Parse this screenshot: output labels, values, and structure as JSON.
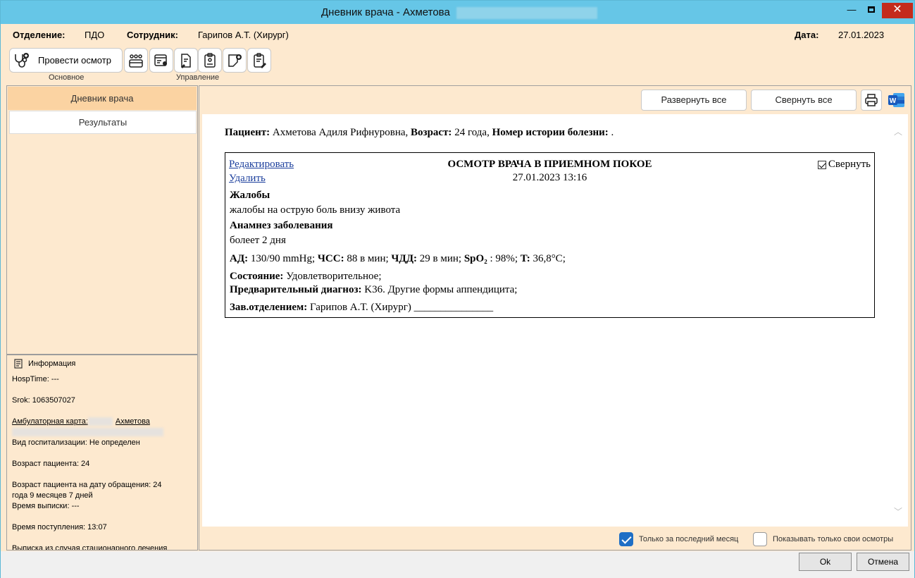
{
  "window": {
    "title": "Дневник врача - Ахметова",
    "minimize": "—",
    "close": "✕"
  },
  "header": {
    "dept_label": "Отделение:",
    "dept_value": "ПДО",
    "employee_label": "Сотрудник:",
    "employee_value": "Гарипов А.Т. (Хирург)",
    "date_label": "Дата:",
    "date_value": "27.01.2023"
  },
  "toolbar": {
    "exam_button": "Провести осмотр",
    "group_main": "Основное",
    "group_manage": "Управление"
  },
  "sidebar": {
    "items": [
      {
        "label": "Дневник врача"
      },
      {
        "label": "Результаты"
      }
    ]
  },
  "info": {
    "title": "Информация",
    "hosp_time": "HospTime: ---",
    "srok": "Srok: 1063507027",
    "amb_card_label": "Амбулаторная карта:",
    "amb_card_name": "Ахметова",
    "hosp_type": "Вид госпитализации: Не определен",
    "age": "Возраст пациента: 24",
    "age_at_visit_1": "Возраст пациента на дату обращения: 24",
    "age_at_visit_2": "года 9 месяцев 7 дней",
    "discharge_time": "Время выписки: ---",
    "admission_time": "Время поступления: 13:07",
    "extract": "Выписка из случая стационарного лечения"
  },
  "actions": {
    "expand_all": "Развернуть все",
    "collapse_all": "Свернуть все"
  },
  "document": {
    "patient_label": "Пациент:",
    "patient_name": "Ахметова Адиля Рифнуровна,",
    "age_label": "Возраст:",
    "age_value": "24 года,",
    "history_label": "Номер истории болезни:",
    "history_value": ".",
    "exam": {
      "edit": "Редактировать",
      "delete": "Удалить",
      "title": "ОСМОТР ВРАЧА В ПРИЕМНОМ ПОКОЕ",
      "datetime": "27.01.2023 13:16",
      "collapse_label": "Свернуть",
      "complaints_title": "Жалобы",
      "complaints_text": "жалобы на острую боль внизу живота",
      "anamnesis_title": "Анамнез заболевания",
      "anamnesis_text": "болеет 2 дня",
      "bp_label": "АД:",
      "bp_value": "130/90 mmHg;",
      "hr_label": "ЧСС:",
      "hr_value": "88 в мин;",
      "rr_label": "ЧДД:",
      "rr_value": "29 в мин;",
      "spo2_label": "SpO₂",
      "spo2_value": ": 98%;",
      "temp_label": "T:",
      "temp_value": "36,8°C;",
      "state_label": "Состояние:",
      "state_value": "Удовлетворительное;",
      "diag_label": "Предварительный диагноз:",
      "diag_value": "K36. Другие формы аппендицита;",
      "head_label": "Зав.отделением:",
      "head_value": "Гарипов А.Т. (Хирург) _______________"
    }
  },
  "filters": {
    "last_month": "Только за последний месяц",
    "last_month_checked": true,
    "own_only": "Показывать только свои осмотры",
    "own_only_checked": false
  },
  "dialog": {
    "ok": "Ok",
    "cancel": "Отмена"
  },
  "colors": {
    "titlebar": "#66c6e7",
    "background": "#fde9cf",
    "active_nav": "#fbd3a2",
    "checkbox_accent": "#1f6fc5"
  }
}
